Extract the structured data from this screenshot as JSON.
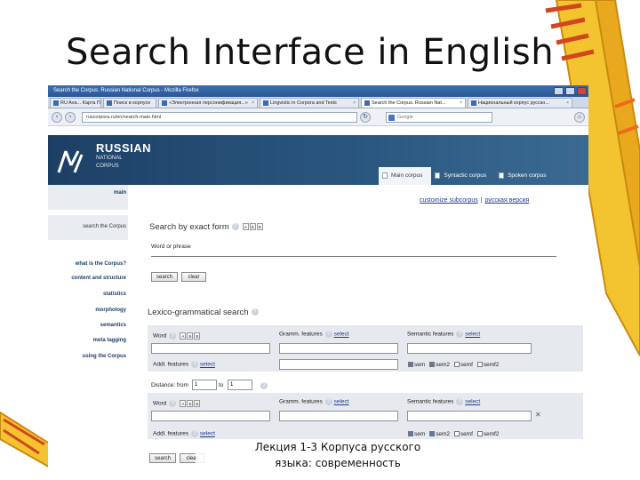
{
  "slide": {
    "title": "Search Interface in English",
    "caption_line1": "Лекция 1-3 Корпуса русского",
    "caption_line2": "языка: современность"
  },
  "browser": {
    "window_title": "Search the Corpus. Russian National Corpus - Mozilla Firefox",
    "tabs": [
      {
        "label": "RU Ava...  Карта Пона"
      },
      {
        "label": "Поиск в корпусе"
      },
      {
        "label": "«Электронная персонификация...»"
      },
      {
        "label": "Lingvistic in Corpora and Texts"
      },
      {
        "label": "Search the Corpus. Russian Nat..."
      },
      {
        "label": "Национальный корпус русско..."
      }
    ],
    "url": "ruscorpora.ru/en/search-main.html",
    "search_placeholder": "Google"
  },
  "site": {
    "logo_line1": "RUSSIAN",
    "logo_line2": "NATIONAL",
    "logo_line3": "CORPUS",
    "corpus_tabs": [
      {
        "label": "Main corpus"
      },
      {
        "label": "Syntactic corpus"
      },
      {
        "label": "Spoken corpus"
      }
    ],
    "top_links": {
      "customize": "customize subcorpus",
      "russian": "русская версия"
    }
  },
  "leftnav": {
    "main": "main",
    "search": "search the Corpus",
    "items": [
      {
        "label": "what is the Corpus?"
      },
      {
        "label": "content and structure"
      },
      {
        "label": "statistics"
      },
      {
        "label": "morphology"
      },
      {
        "label": "semantics"
      },
      {
        "label": "meta tagging"
      },
      {
        "label": "using the Corpus"
      }
    ]
  },
  "exact": {
    "title": "Search by exact form",
    "field_label": "Word or phrase",
    "search_btn": "search",
    "clear_btn": "clear"
  },
  "lexgram": {
    "title": "Lexico-grammatical search",
    "word": "Word",
    "gramm": "Gramm. features",
    "semantic": "Semantic features",
    "select": "select",
    "addl": "Addl. features",
    "sem": "sem",
    "sem2": "sem2",
    "semf": "semf",
    "semf2": "semf2",
    "distance_from": "Distance: from",
    "to": "to",
    "from_value": "1",
    "to_value": "1",
    "search_btn": "search",
    "clear_btn": "clear"
  }
}
